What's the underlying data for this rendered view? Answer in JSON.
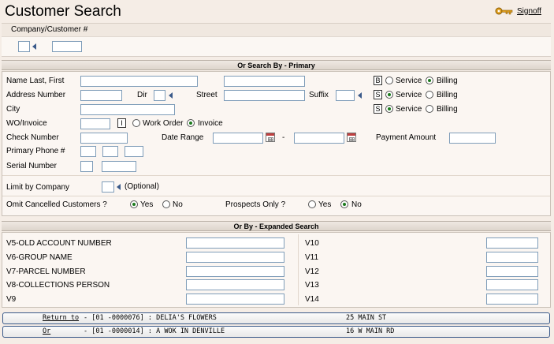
{
  "header": {
    "title": "Customer Search",
    "signoff_label": "Signoff"
  },
  "company": {
    "label": "Company/Customer #"
  },
  "primary": {
    "heading": "Or Search By - Primary",
    "name_label": "Name Last, First",
    "address_label": "Address Number",
    "dir_label": "Dir",
    "street_label": "Street",
    "suffix_label": "Suffix",
    "city_label": "City",
    "wo_label": "WO/Invoice",
    "wo_flag": "I",
    "work_order_label": "Work Order",
    "invoice_label": "Invoice",
    "check_label": "Check Number",
    "date_range_label": "Date Range",
    "date_sep": "-",
    "payment_label": "Payment Amount",
    "phone_label": "Primary Phone #",
    "serial_label": "Serial Number",
    "limit_label": "Limit by Company",
    "optional_label": "(Optional)",
    "omit_label": "Omit Cancelled Customers ?",
    "prospects_label": "Prospects Only ?",
    "yes_label": "Yes",
    "no_label": "No",
    "addr_types": [
      {
        "flag": "B",
        "service": "Service",
        "billing": "Billing",
        "selected": "billing"
      },
      {
        "flag": "S",
        "service": "Service",
        "billing": "Billing",
        "selected": "service"
      },
      {
        "flag": "S",
        "service": "Service",
        "billing": "Billing",
        "selected": "service"
      }
    ]
  },
  "expanded": {
    "heading": "Or By - Expanded Search",
    "left": [
      "V5-OLD ACCOUNT NUMBER",
      "V6-GROUP NAME",
      "V7-PARCEL NUMBER",
      "V8-COLLECTIONS PERSON",
      "V9"
    ],
    "right": [
      "V10",
      "V11",
      "V12",
      "V13",
      "V14"
    ]
  },
  "recent": [
    {
      "prefix": "Return to",
      "id": "- [01 -0000076] : DELIA'S FLOWERS",
      "address": "25 MAIN ST"
    },
    {
      "prefix": "Or",
      "id": "- [01 -0000014] : A WOK IN DENVILLE",
      "address": "16 W MAIN RD"
    }
  ]
}
